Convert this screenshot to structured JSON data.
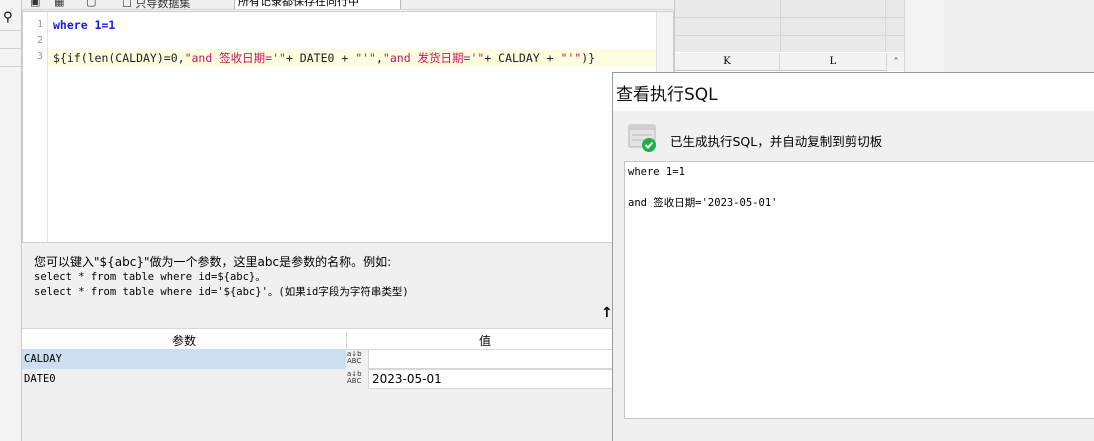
{
  "toolbar": {
    "checkbox_label": "只导数据集",
    "combo_value": "所有记录都保存在同行中"
  },
  "editor": {
    "line_numbers": [
      "1",
      "2",
      "3"
    ],
    "line1": {
      "kw": "where",
      "rest": " 1=1"
    },
    "line3": {
      "p1": "${if(len(CALDAY)=0,",
      "s1": "\"and 签收日期='\"",
      "p2": "+ DATE0 + ",
      "s2": "\"'\"",
      "p3": ",",
      "s3": "\"and 发货日期='\"",
      "p4": "+ CALDAY + ",
      "s4": "\"'\"",
      "p5": ")}"
    }
  },
  "hint": {
    "line1": "您可以键入\"${abc}\"做为一个参数，这里abc是参数的名称。例如:",
    "line2": "select * from table where id=${abc}。",
    "line3": "select * from table where id='${abc}'。(如果id字段为字符串类型)"
  },
  "params": {
    "header_param": "参数",
    "header_value": "值",
    "rows": [
      {
        "name": "CALDAY",
        "value": ""
      },
      {
        "name": "DATE0",
        "value": "2023-05-01"
      }
    ],
    "type_icon_text": "a↓b ABC"
  },
  "sheet": {
    "columns": [
      "K",
      "L"
    ]
  },
  "dialog": {
    "title": "查看执行SQL",
    "message": "已生成执行SQL，并自动复制到剪切板",
    "result_line1": "where 1=1",
    "result_line3": "and 签收日期='2023-05-01'"
  },
  "colors": {
    "keyword": "#1a1ae6",
    "string": "#c2185b",
    "selected_row": "#cbdff0",
    "check_green": "#1fae4b"
  }
}
